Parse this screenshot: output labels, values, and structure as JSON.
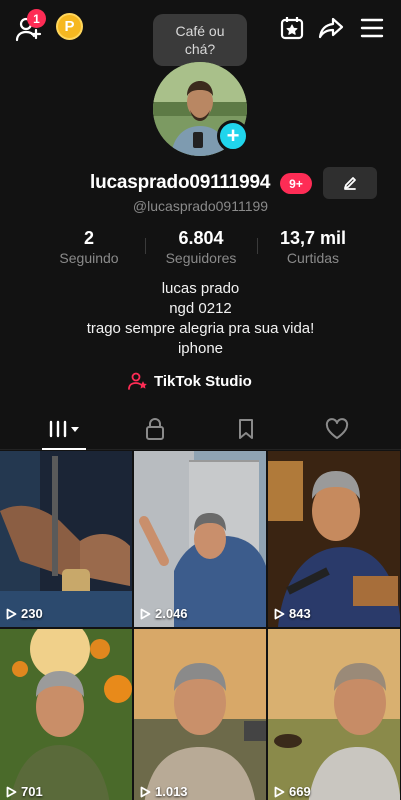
{
  "header": {
    "add_friend_icon": "add-user-icon",
    "friend_request_count": "1",
    "coin_label": "P",
    "calendar_icon": "calendar-star-icon",
    "share_icon": "share-icon",
    "menu_icon": "hamburger-menu-icon"
  },
  "profile": {
    "note_bubble": "Café ou\nchá?",
    "username": "lucasprado09111994",
    "notification_badge": "9+",
    "handle": "@lucasprado0911199",
    "stats": [
      {
        "value": "2",
        "label": "Seguindo"
      },
      {
        "value": "6.804",
        "label": "Seguidores"
      },
      {
        "value": "13,7 mil",
        "label": "Curtidas"
      }
    ],
    "bio": [
      "lucas prado",
      "ngd 0212",
      "trago sempre alegria pra sua vida!",
      "iphone"
    ],
    "studio_label": "TikTok Studio"
  },
  "tabs": [
    "videos-grid",
    "private",
    "saved",
    "liked"
  ],
  "videos": [
    {
      "views": "230"
    },
    {
      "views": "2.046"
    },
    {
      "views": "843"
    },
    {
      "views": "701"
    },
    {
      "views": "1.013"
    },
    {
      "views": "669"
    }
  ],
  "colors": {
    "background": "#121212",
    "accent_red": "#fe2c55",
    "accent_cyan": "#20d5ec",
    "coin": "#f6b821",
    "muted_text": "#8a8a8a"
  }
}
